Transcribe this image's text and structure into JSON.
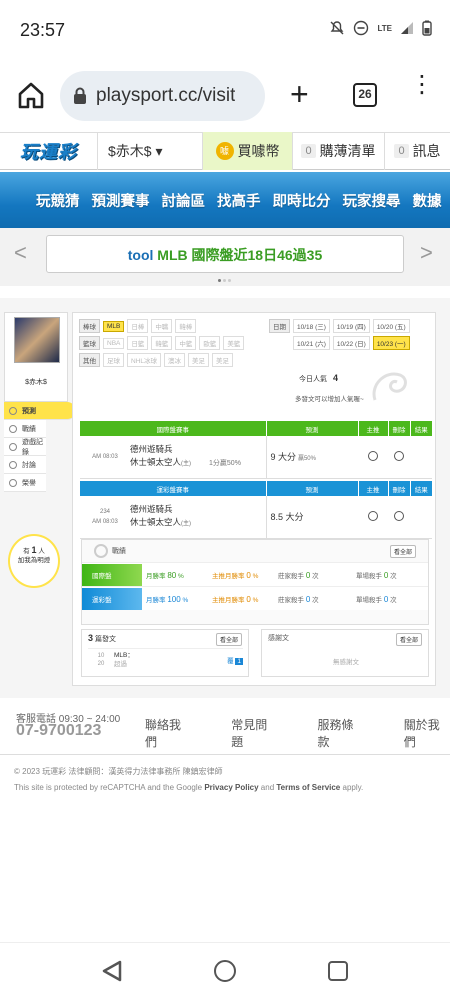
{
  "status": {
    "time": "23:57",
    "lte": "LTE"
  },
  "browser": {
    "url": "playsport.cc/visit",
    "tab_count": "26"
  },
  "topnav": {
    "logo": "玩運彩",
    "user": "$赤木$ ▾",
    "buy_coin": "買噱幣",
    "cart_count": "0",
    "cart": "購薄清單",
    "msg_count": "0",
    "msg": "訊息"
  },
  "menu": [
    "玩競猜",
    "預測賽事",
    "討論區",
    "找高手",
    "即時比分",
    "玩家搜尋",
    "數據"
  ],
  "banner": {
    "part1": "tool",
    "part2": "MLB 國際盤近18日46過35"
  },
  "sidebar": {
    "username": "$赤木$",
    "items": [
      "預測",
      "戰績",
      "遊戲記錄",
      "討論",
      "榮譽"
    ],
    "bulb_line1": "有",
    "bulb_count": "1",
    "bulb_unit": "人",
    "bulb_line2": "加我為明燈"
  },
  "filter": {
    "rows": [
      {
        "label": "棒球",
        "tags": [
          "MLB",
          "日棒",
          "中職",
          "韓棒"
        ]
      },
      {
        "label": "籃球",
        "tags": [
          "NBA",
          "日籃",
          "韓籃",
          "中籃",
          "歐籃",
          "美籃"
        ]
      },
      {
        "label": "其他",
        "tags": [
          "足球",
          "NHL冰球",
          "澳冰",
          "美足",
          "美足"
        ]
      }
    ],
    "date_label": "日期",
    "dates": [
      "10/18 (三)",
      "10/19 (四)",
      "10/20 (五)",
      "10/21 (六)",
      "10/22 (日)",
      "10/23 (一)"
    ]
  },
  "popularity": {
    "label": "今日人氣",
    "value": "4",
    "note": "多發文可以增加人氣喔~"
  },
  "table1": {
    "headers": [
      "國際盤賽事",
      "預測",
      "主推",
      "刪除",
      "結果"
    ],
    "time": "AM 08:03",
    "team1": "德州遊騎兵",
    "team2": "休士頓太空人",
    "team2_note": "(主)",
    "line": "1分贏50%",
    "pred_main": "9 大分",
    "pred_sub": "贏50%"
  },
  "table2": {
    "headers": [
      "運彩盤賽事",
      "預測",
      "主推",
      "刪除",
      "結果"
    ],
    "game_no": "234",
    "time": "AM 08:03",
    "team1": "德州遊騎兵",
    "team2": "休士頓太空人",
    "team2_note": "(主)",
    "pred_main": "8.5 大分"
  },
  "record": {
    "title": "戰績",
    "view_all": "看全部",
    "rows": [
      {
        "label": "國際盤",
        "win_label": "月勝率",
        "win_value": "80",
        "main_label": "主推月勝率",
        "main_value": "0",
        "king_label": "莊家殺手",
        "king_value": "0",
        "single_label": "單場殺手",
        "single_value": "0"
      },
      {
        "label": "運彩盤",
        "win_label": "月勝率",
        "win_value": "100",
        "main_label": "主推月勝率",
        "main_value": "0",
        "king_label": "莊家殺手",
        "king_value": "0",
        "single_label": "單場殺手",
        "single_value": "0"
      }
    ],
    "pct": "%",
    "unit": "次"
  },
  "posts": {
    "count": "3",
    "label": "篇發文",
    "view_all": "看全部",
    "date_m": "10",
    "date_d": "20",
    "cat": "MLB：",
    "sub": "超過",
    "reply_label": "覆",
    "reply_count": "1"
  },
  "thanks": {
    "label": "感謝文",
    "view_all": "看全部",
    "empty": "無感謝文"
  },
  "footer": {
    "service": "客服電話 09:30 ~ 24:00",
    "phone": "07-9700123",
    "links": [
      "聯絡我們",
      "常見問題",
      "服務條款",
      "關於我們"
    ],
    "copyright": "© 2023 玩運彩 法律顧問：漢英得力法律事務所 陳鎮宏律師",
    "recaptcha_pre": "This site is protected by reCAPTCHA and the Google ",
    "privacy": "Privacy Policy",
    "and": " and ",
    "terms": "Terms of Service",
    "apply": " apply."
  }
}
